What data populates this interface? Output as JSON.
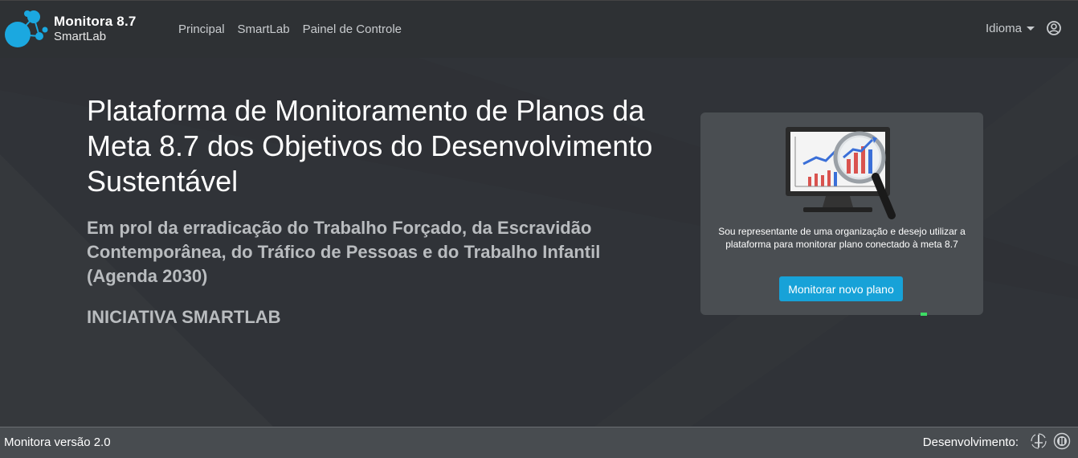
{
  "brand": {
    "title": "Monitora 8.7",
    "subtitle": "SmartLab",
    "color": "#1ba8e0"
  },
  "nav": {
    "links": [
      "Principal",
      "SmartLab",
      "Painel de Controle"
    ],
    "language_label": "Idioma",
    "user_icon": "user-circle-icon"
  },
  "hero": {
    "title": "Plataforma de Monitoramento de Planos da Meta 8.7 dos Objetivos do Desenvolvimento Sustentável",
    "subtitle": "Em prol da erradicação do Trabalho Forçado, da Escravidão Contemporânea, do Tráfico de Pessoas e do Trabalho Infantil (Agenda 2030)",
    "initiative": "INICIATIVA SMARTLAB"
  },
  "card": {
    "illustration": "monitor-chart-magnifier-icon",
    "text": "Sou representante de uma organização e desejo utilizar a plataforma para monitorar plano conectado à meta 8.7",
    "button_label": "Monitorar novo plano",
    "button_color": "#17a2d8"
  },
  "footer": {
    "version": "Monitora versão 2.0",
    "development_label": "Desenvolvimento:",
    "logos": [
      "mpt-logo-icon",
      "oit-logo-icon"
    ]
  }
}
